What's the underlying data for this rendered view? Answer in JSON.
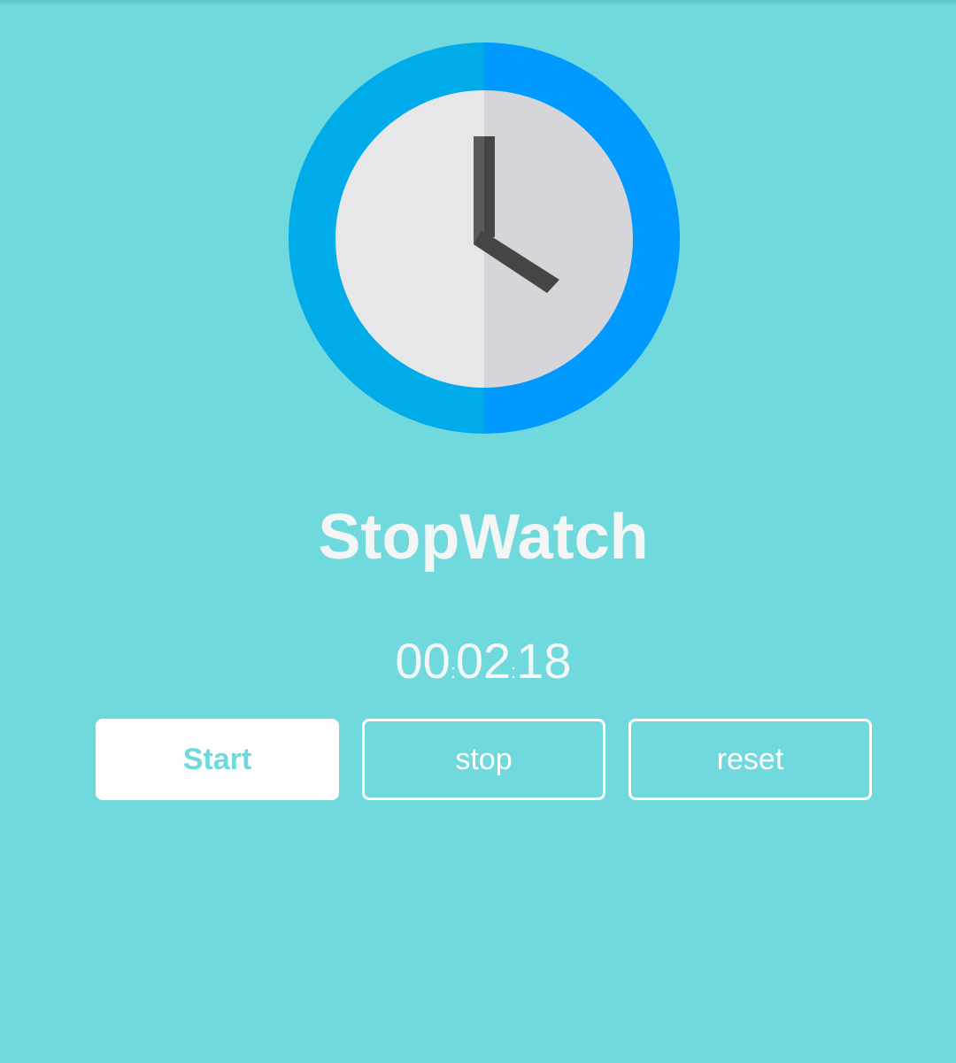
{
  "app": {
    "title": "StopWatch"
  },
  "timer": {
    "hours": "00",
    "minutes": "02",
    "seconds": "18",
    "separator": ":"
  },
  "buttons": {
    "start_label": "Start",
    "stop_label": "stop",
    "reset_label": "reset"
  },
  "icons": {
    "main": "clock-icon"
  },
  "colors": {
    "background": "#6fd9dd",
    "clock_ring_left": "#00abea",
    "clock_ring_right": "#0099ff",
    "clock_face_left": "#e7e7e9",
    "clock_face_right": "#d5d5da",
    "clock_hands": "#4a4a4a",
    "button_fill": "#ffffff",
    "button_text_primary": "#6fd9dd"
  }
}
